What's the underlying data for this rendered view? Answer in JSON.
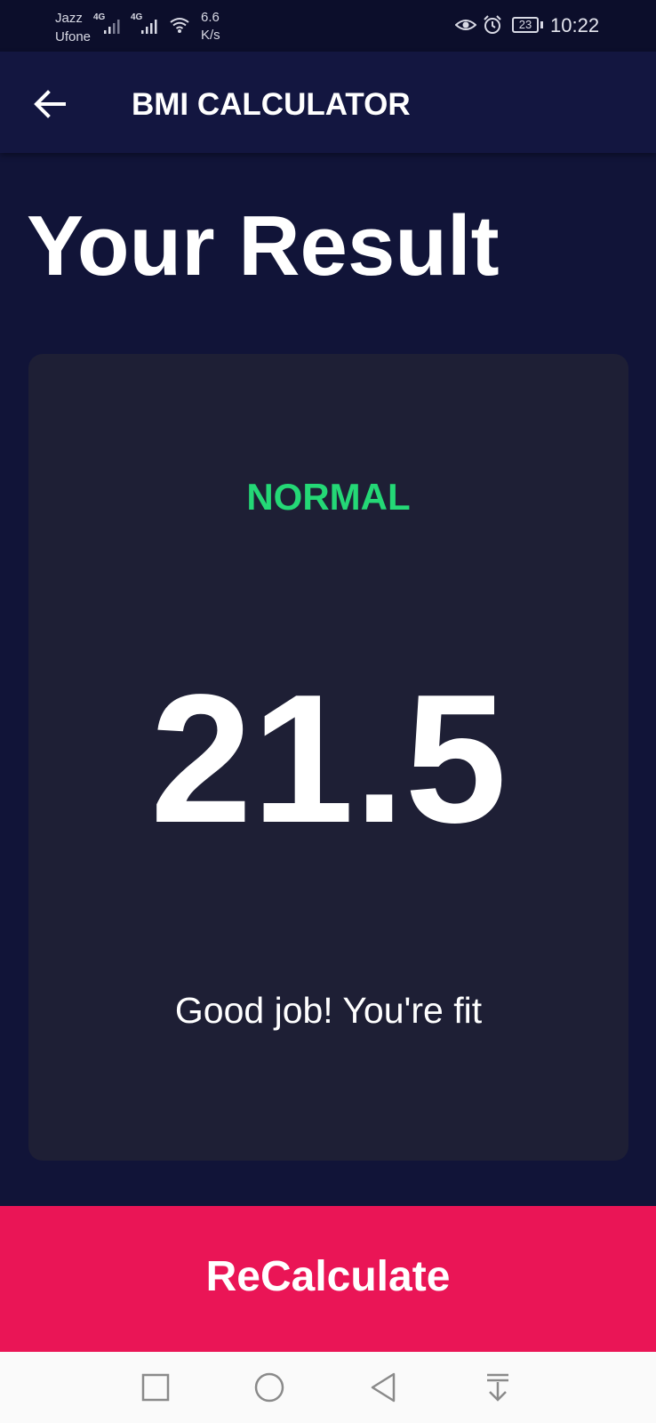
{
  "status_bar": {
    "carrier_1": "Jazz",
    "carrier_2": "Ufone",
    "network_1": "4G",
    "network_2": "4G",
    "speed_value": "6.6",
    "speed_unit": "K/s",
    "battery": "23",
    "time": "10:22"
  },
  "app_bar": {
    "title": "BMI CALCULATOR"
  },
  "page": {
    "heading": "Your Result"
  },
  "result": {
    "category": "NORMAL",
    "bmi": "21.5",
    "message": "Good job! You're fit"
  },
  "actions": {
    "recalculate_label": "ReCalculate"
  },
  "colors": {
    "background": "#111438",
    "card": "#1e1f35",
    "category_normal": "#24d876",
    "accent": "#ea1556"
  },
  "icons": {
    "back": "arrow-left-icon",
    "nav_recent": "square-icon",
    "nav_home": "circle-icon",
    "nav_back": "triangle-back-icon",
    "nav_notification": "pull-down-icon"
  }
}
